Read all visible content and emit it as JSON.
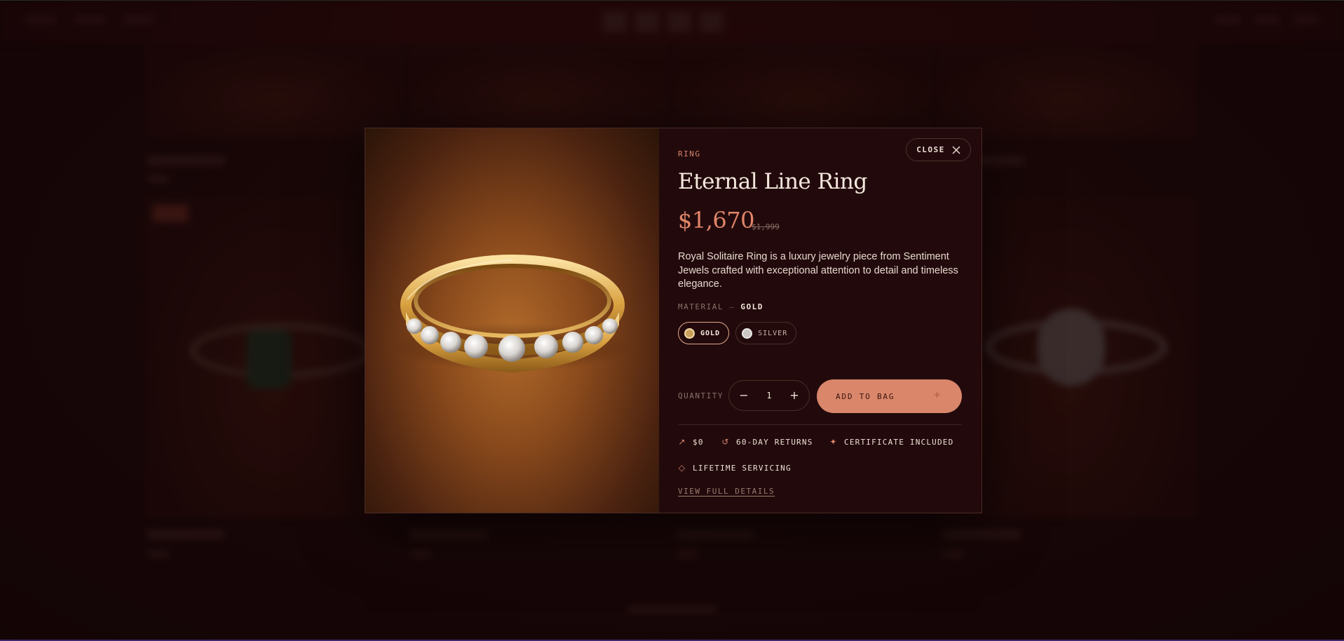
{
  "product": {
    "category": "RING",
    "title": "Eternal Line Ring",
    "price": "$1,670",
    "compare_price": "$1,999",
    "description": "Royal Solitaire Ring is a luxury jewelry piece from Sentiment Jewels crafted with exceptional attention to detail and timeless elegance."
  },
  "material": {
    "label": "MATERIAL",
    "separator": "—",
    "selected": "GOLD",
    "options": [
      {
        "label": "GOLD",
        "color": "#c9a15a",
        "active": true
      },
      {
        "label": "SILVER",
        "color": "#c9c6c4",
        "active": false
      }
    ]
  },
  "quantity": {
    "label": "QUANTITY",
    "value": "1",
    "decrement": "−",
    "increment": "+"
  },
  "cart": {
    "add_label": "ADD TO BAG",
    "add_icon": "+"
  },
  "features": [
    {
      "icon": "arrow-up-right-icon",
      "label": "$0"
    },
    {
      "icon": "refresh-icon",
      "label": "60-DAY RETURNS"
    },
    {
      "icon": "sparkle-icon",
      "label": "CERTIFICATE INCLUDED"
    },
    {
      "icon": "diamond-icon",
      "label": "LIFETIME SERVICING"
    }
  ],
  "details_link": "VIEW FULL DETAILS",
  "close_label": "CLOSE",
  "colors": {
    "accent": "#d9866a",
    "modal_bg": "#220a0c",
    "page_bg": "#1a0708"
  }
}
